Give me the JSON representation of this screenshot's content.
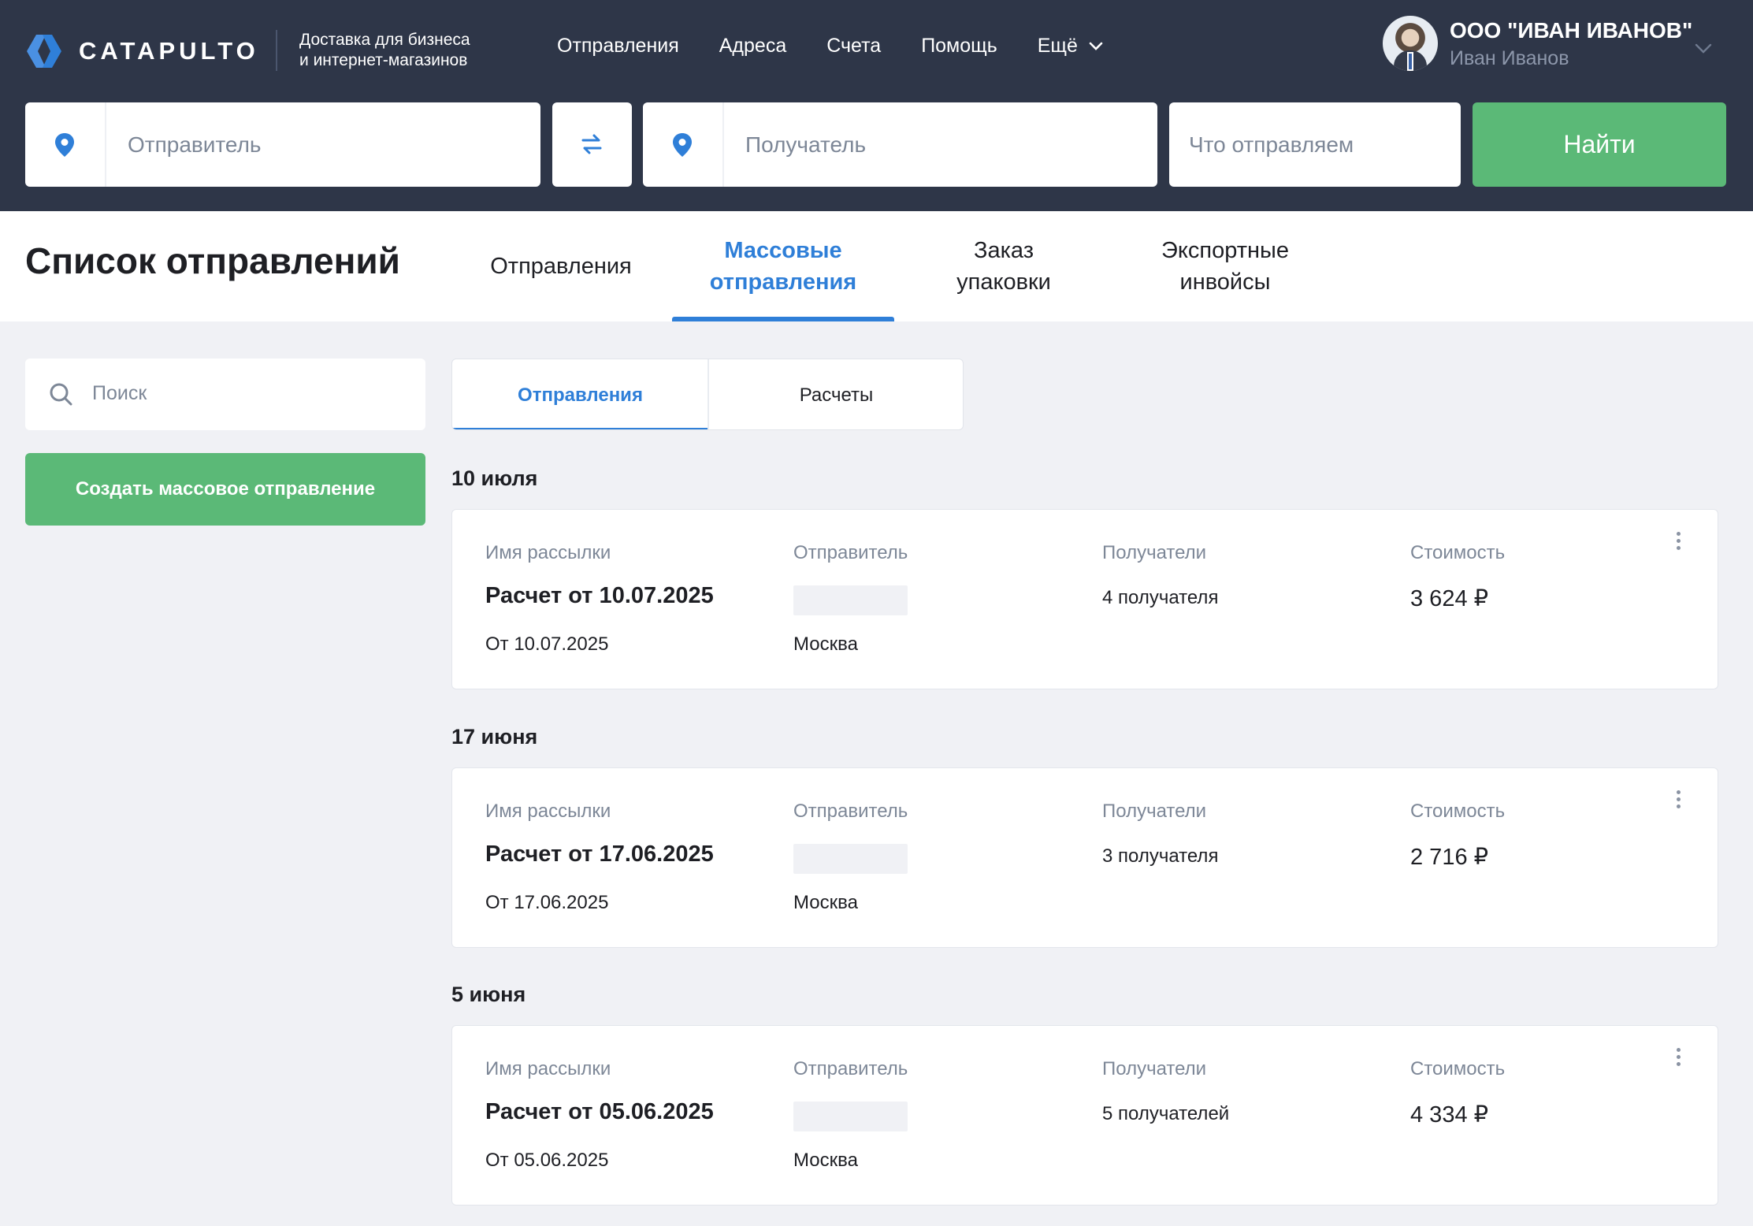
{
  "header": {
    "logo_text": "CATAPULTO",
    "tagline_line1": "Доставка для бизнеса",
    "tagline_line2": "и интернет-магазинов",
    "nav": [
      "Отправления",
      "Адреса",
      "Счета",
      "Помощь",
      "Ещё"
    ],
    "company": "ООО \"ИВАН ИВАНОВ\"",
    "user_name": "Иван Иванов"
  },
  "search_bar": {
    "sender_placeholder": "Отправитель",
    "recipient_placeholder": "Получатель",
    "what_placeholder": "Что отправляем",
    "find_label": "Найти"
  },
  "page": {
    "title": "Список отправлений",
    "tabs": [
      {
        "line1": "Отправления",
        "line2": ""
      },
      {
        "line1": "Массовые",
        "line2": "отправления"
      },
      {
        "line1": "Заказ",
        "line2": "упаковки"
      },
      {
        "line1": "Экспортные",
        "line2": "инвойсы"
      }
    ],
    "active_tab": "Массовые отправления"
  },
  "sidebar": {
    "search_placeholder": "Поиск",
    "create_label": "Создать массовое отправление"
  },
  "subtabs": {
    "items": [
      "Отправления",
      "Расчеты"
    ],
    "active": "Отправления"
  },
  "columns": {
    "name": "Имя рассылки",
    "sender": "Отправитель",
    "recipients": "Получатели",
    "cost": "Стоимость"
  },
  "groups": [
    {
      "date": "10 июля",
      "mailing": {
        "name": "Расчет от 10.07.2025",
        "from": "От 10.07.2025",
        "city": "Москва",
        "recipients": "4 получателя",
        "cost": "3 624 ₽"
      }
    },
    {
      "date": "17 июня",
      "mailing": {
        "name": "Расчет от 17.06.2025",
        "from": "От 17.06.2025",
        "city": "Москва",
        "recipients": "3 получателя",
        "cost": "2 716 ₽"
      }
    },
    {
      "date": "5 июня",
      "mailing": {
        "name": "Расчет от 05.06.2025",
        "from": "От 05.06.2025",
        "city": "Москва",
        "recipients": "5 получателей",
        "cost": "4 334 ₽"
      }
    }
  ],
  "colors": {
    "header_bg": "#2e3648",
    "accent_blue": "#2f7fd8",
    "accent_green": "#5bb977",
    "page_bg": "#f0f1f5"
  }
}
